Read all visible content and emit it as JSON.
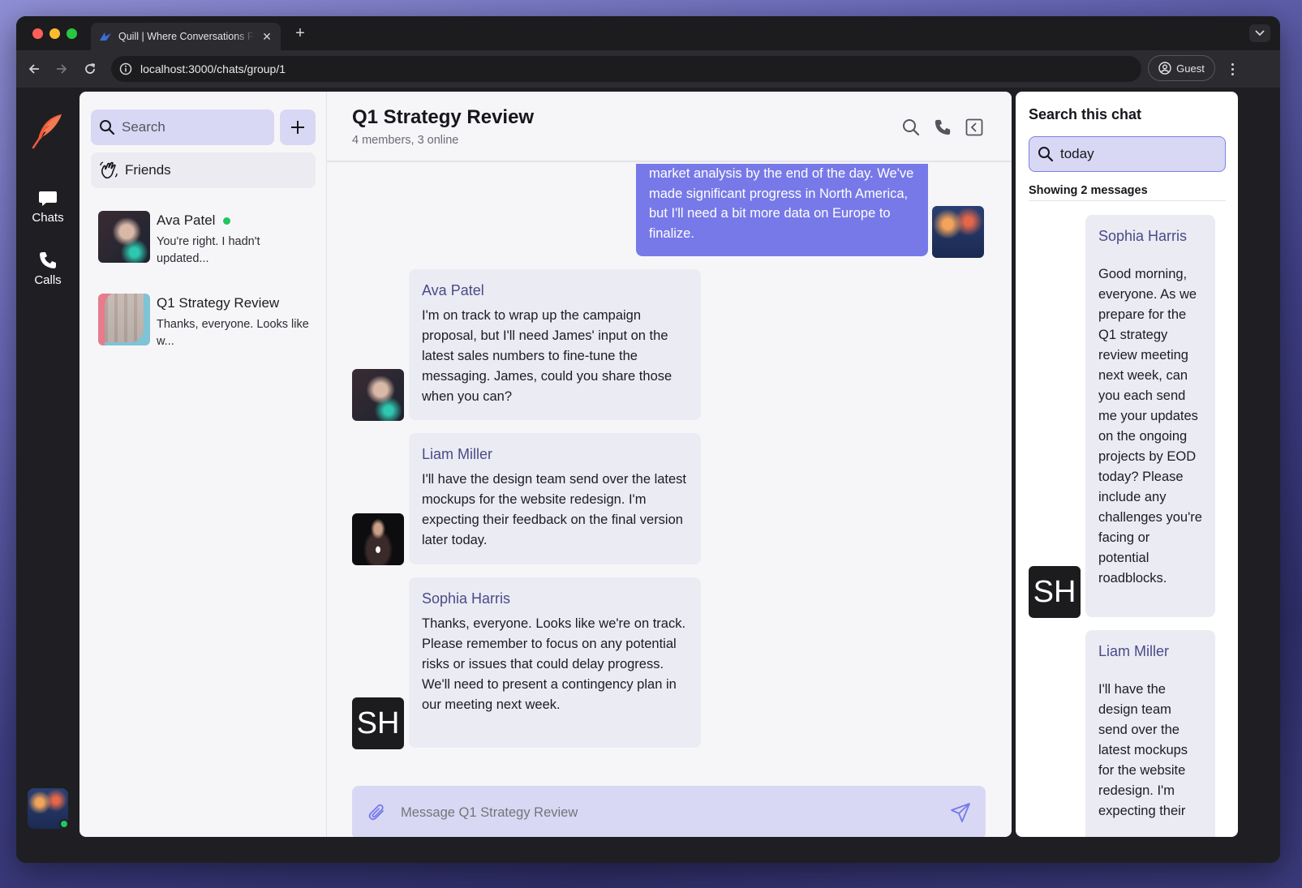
{
  "browser": {
    "tab_title": "Quill | Where Conversations F",
    "url": "localhost:3000/chats/group/1",
    "profile_label": "Guest"
  },
  "rail": {
    "items": [
      {
        "label": "Chats",
        "icon": "chat-bubble-icon"
      },
      {
        "label": "Calls",
        "icon": "phone-icon"
      }
    ]
  },
  "sidebar": {
    "search_placeholder": "Search",
    "friends_label": "Friends",
    "conversations": [
      {
        "name": "Ava Patel",
        "preview": "You're right. I hadn't updated...",
        "online": true
      },
      {
        "name": "Q1 Strategy Review",
        "preview": "Thanks, everyone. Looks like w...",
        "online": false
      }
    ]
  },
  "chat": {
    "title": "Q1 Strategy Review",
    "subtitle": "4 members, 3 online",
    "own_message": "market analysis by the end of the day. We've made significant progress in North America, but I'll need a bit more data on Europe to finalize.",
    "messages": [
      {
        "sender": "Ava Patel",
        "text": "I'm on track to wrap up the campaign proposal, but I'll need James' input on the latest sales numbers to fine-tune the messaging. James, could you share those when you can?"
      },
      {
        "sender": "Liam Miller",
        "text": "I'll have the design team send over the latest mockups for the website redesign. I'm expecting their feedback on the final version later today."
      },
      {
        "sender": "Sophia Harris",
        "initials": "SH",
        "text": "Thanks, everyone. Looks like we're on track. Please remember to focus on any potential risks or issues that could delay progress. We'll need to present a contingency plan in our meeting next week."
      }
    ],
    "composer_placeholder": "Message Q1 Strategy Review"
  },
  "search_panel": {
    "title": "Search this chat",
    "query": "today",
    "result_count": "Showing 2 messages",
    "results": [
      {
        "sender": "Sophia Harris",
        "initials": "SH",
        "text": "Good morning, everyone. As we prepare for the Q1 strategy review meeting next week, can you each send me your updates on the ongoing projects by EOD today? Please include any challenges you're facing or potential roadblocks."
      },
      {
        "sender": "Liam Miller",
        "text": "I'll have the design team send over the latest mockups for the website redesign. I'm expecting their"
      }
    ]
  },
  "colors": {
    "accent": "#7779e8",
    "accent_light": "#d8d8f5",
    "online": "#22c55e",
    "sender_name": "#4a4a8a",
    "logo": "#f05a3a"
  }
}
